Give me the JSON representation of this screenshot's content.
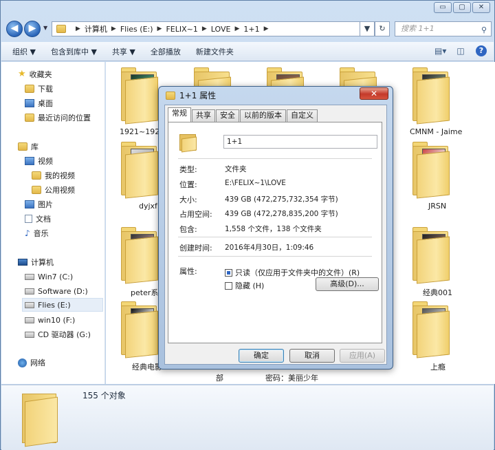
{
  "window": {
    "caption_buttons": [
      "▭",
      "▢",
      "✕"
    ]
  },
  "address": {
    "back": "◀",
    "forward": "▶",
    "crumbs": [
      "计算机",
      "Flies (E:)",
      "FELIX~1",
      "LOVE",
      "1+1"
    ],
    "refresh": "↻",
    "search_placeholder": "搜索 1+1"
  },
  "toolbar": {
    "organize": "组织 ▼",
    "include": "包含到库中 ▼",
    "share": "共享 ▼",
    "play": "全部播放",
    "new_folder": "新建文件夹",
    "help": "?"
  },
  "sidebar": {
    "favorites": "收藏夹",
    "downloads": "下载",
    "desktop": "桌面",
    "recent": "最近访问的位置",
    "libraries": "库",
    "videos": "视频",
    "my_videos": "我的视频",
    "public_videos": "公用视频",
    "pictures": "图片",
    "documents": "文档",
    "music": "音乐",
    "computer": "计算机",
    "drive_c": "Win7 (C:)",
    "drive_d": "Software (D:)",
    "drive_e": "Flies (E:)",
    "drive_f": "win10 (F:)",
    "drive_g": "CD 驱动器 (G:)",
    "network": "网络"
  },
  "folders": {
    "f1": "1921~192",
    "f2": "CMNM - Jaime",
    "f3": "dyjxf",
    "f4": "JRSN",
    "f5": "peter系",
    "f6": "经典001",
    "f7": "经典电影",
    "f8": "上瘾",
    "f9": "部",
    "f10": "密码：美丽少年"
  },
  "details": {
    "count": "155 个对象"
  },
  "dialog": {
    "title": "1+1 属性",
    "close": "✕",
    "tabs": [
      "常规",
      "共享",
      "安全",
      "以前的版本",
      "自定义"
    ],
    "name": "1+1",
    "type_label": "类型:",
    "type_value": "文件夹",
    "location_label": "位置:",
    "location_value": "E:\\FELIX~1\\LOVE",
    "size_label": "大小:",
    "size_value": "439 GB (472,275,732,354 字节)",
    "disk_label": "占用空间:",
    "disk_value": "439 GB (472,278,835,200 字节)",
    "contains_label": "包含:",
    "contains_value": "1,558 个文件，138 个文件夹",
    "created_label": "创建时间:",
    "created_value": "2016年4月30日，1:09:46",
    "attributes_label": "属性:",
    "readonly_label": "只读（仅应用于文件夹中的文件）(R)",
    "hidden_label": "隐藏 (H)",
    "advanced": "高级(D)...",
    "ok": "确定",
    "cancel": "取消",
    "apply": "应用(A)"
  }
}
